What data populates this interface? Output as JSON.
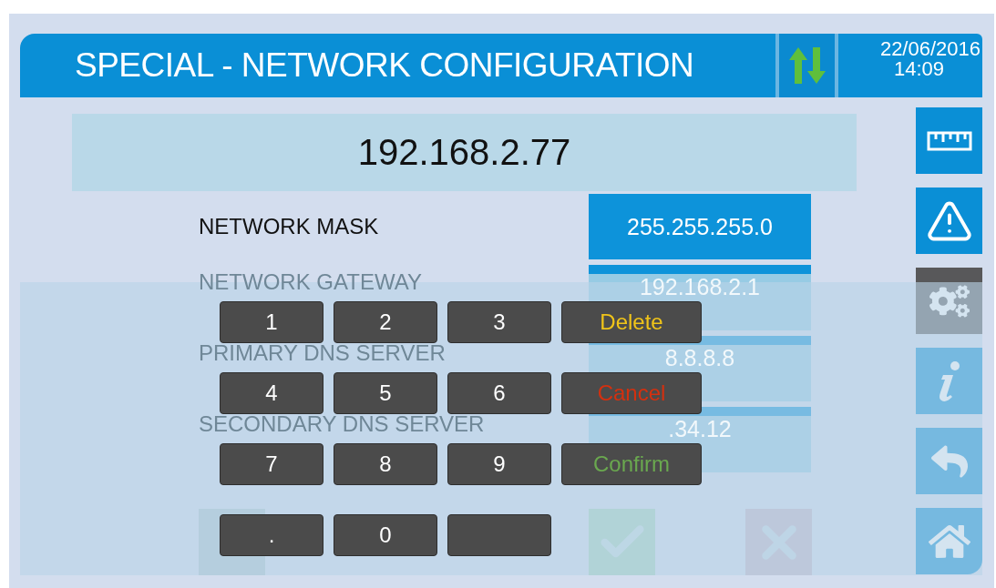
{
  "header": {
    "title": "SPECIAL - NETWORK CONFIGURATION",
    "date": "22/06/2016",
    "time": "14:09"
  },
  "address": {
    "value": "192.168.2.77"
  },
  "fields": [
    {
      "label": "NETWORK MASK",
      "value": "255.255.255.0",
      "dimmed": false
    },
    {
      "label": "NETWORK GATEWAY",
      "value": "192.168.2.1",
      "dimmed": true
    },
    {
      "label": "PRIMARY DNS SERVER",
      "value": "8.8.8.8",
      "dimmed": true
    },
    {
      "label": "SECONDARY DNS SERVER",
      "value": ".34.12",
      "dimmed": true
    }
  ],
  "actions": [
    {
      "kind": "blank"
    },
    {
      "kind": "confirm"
    },
    {
      "kind": "cancel"
    }
  ],
  "sidebar": {
    "items": [
      {
        "kind": "ruler",
        "selected": false
      },
      {
        "kind": "alert",
        "selected": false
      },
      {
        "kind": "settings",
        "selected": true
      },
      {
        "kind": "info",
        "selected": false
      },
      {
        "kind": "back",
        "selected": false
      },
      {
        "kind": "home",
        "selected": false
      }
    ]
  },
  "keypad": {
    "keys": [
      {
        "kind": "digit",
        "label": "1"
      },
      {
        "kind": "digit",
        "label": "2"
      },
      {
        "kind": "digit",
        "label": "3"
      },
      {
        "kind": "action",
        "label": "Delete",
        "color": "#f0c419"
      },
      {
        "kind": "digit",
        "label": "4"
      },
      {
        "kind": "digit",
        "label": "5"
      },
      {
        "kind": "digit",
        "label": "6"
      },
      {
        "kind": "action",
        "label": "Cancel",
        "color": "#d4300f"
      },
      {
        "kind": "digit",
        "label": "7"
      },
      {
        "kind": "digit",
        "label": "8"
      },
      {
        "kind": "digit",
        "label": "9"
      },
      {
        "kind": "action",
        "label": "Confirm",
        "color": "#6aa84f"
      },
      {
        "kind": "digit",
        "label": "."
      },
      {
        "kind": "digit",
        "label": "0"
      },
      {
        "kind": "blank"
      }
    ]
  }
}
